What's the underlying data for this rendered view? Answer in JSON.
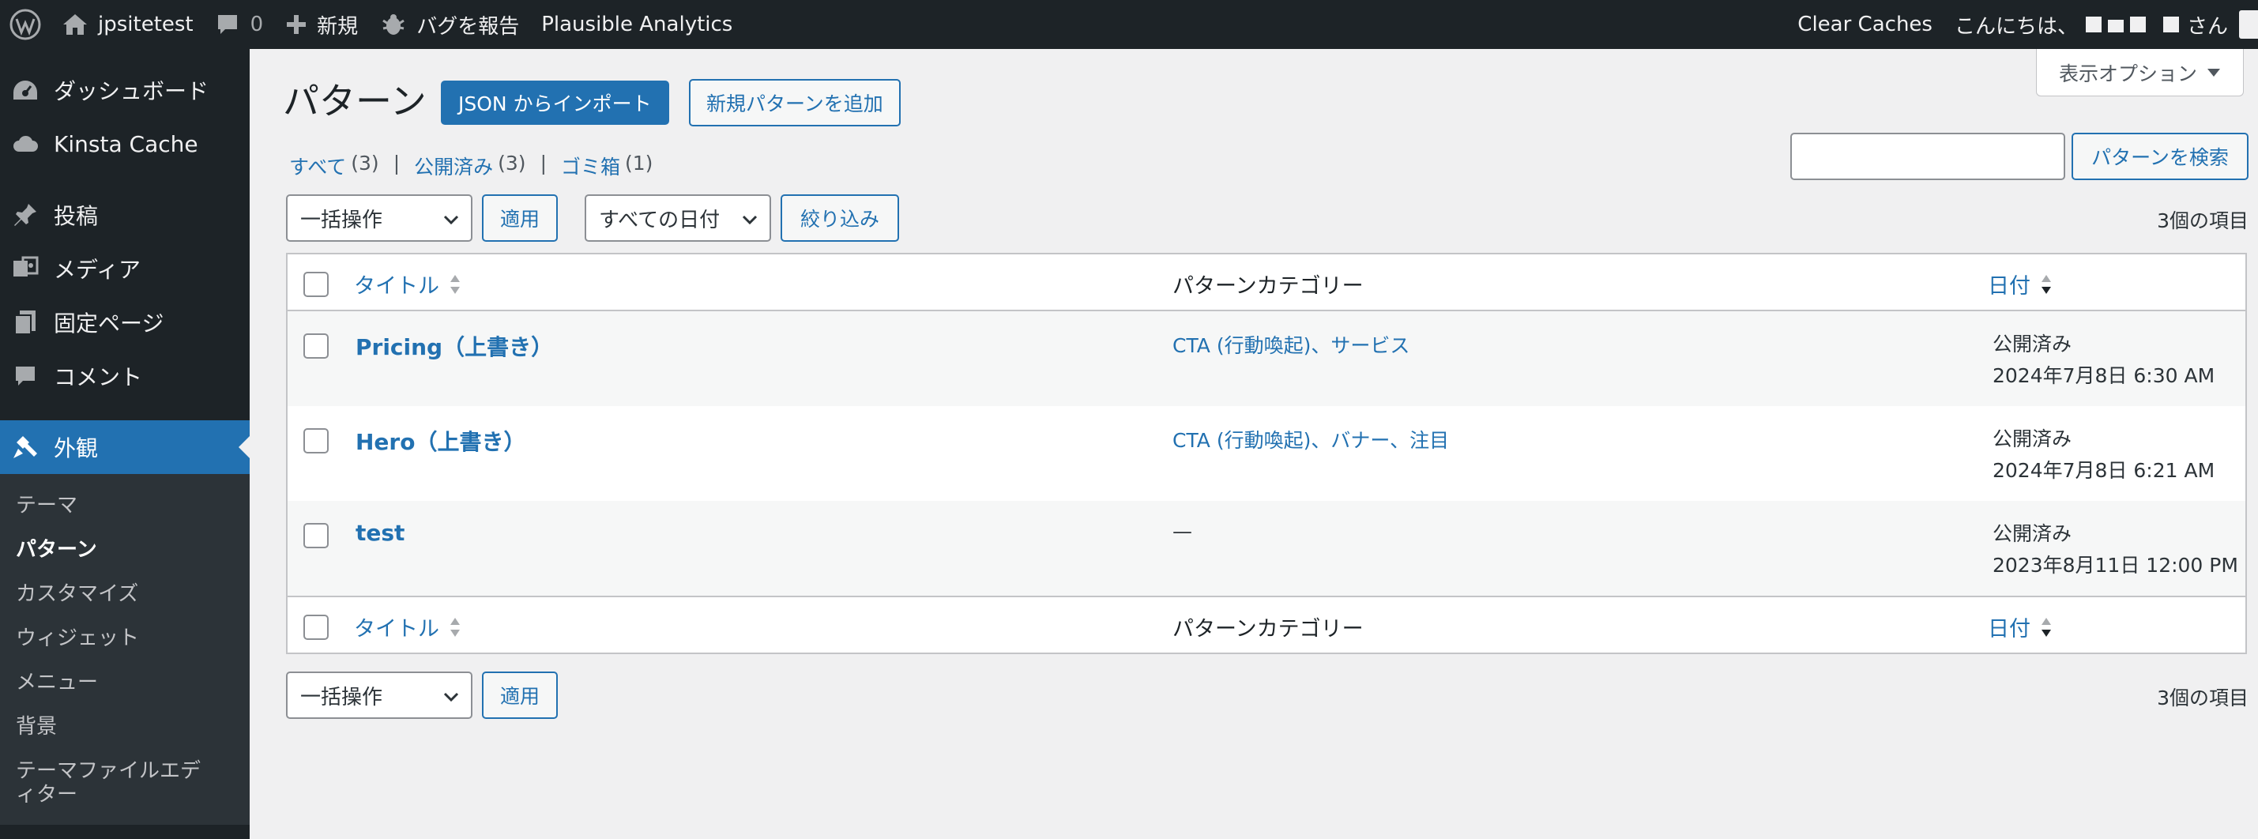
{
  "adminbar": {
    "site_name": "jpsitetest",
    "comments_count": "0",
    "new_label": "新規",
    "bug_report": "バグを報告",
    "analytics": "Plausible Analytics",
    "clear_caches": "Clear Caches",
    "greeting": "こんにちは、",
    "san": "さん"
  },
  "sidebar": {
    "items": [
      {
        "label": "ダッシュボード",
        "icon": "dashboard-icon"
      },
      {
        "label": "Kinsta Cache",
        "icon": "cloud-icon"
      },
      {
        "label": "投稿",
        "icon": "pin-icon"
      },
      {
        "label": "メディア",
        "icon": "media-icon"
      },
      {
        "label": "固定ページ",
        "icon": "pages-icon"
      },
      {
        "label": "コメント",
        "icon": "comment-icon"
      },
      {
        "label": "外観",
        "icon": "appearance-icon"
      }
    ],
    "submenu": [
      "テーマ",
      "パターン",
      "カスタマイズ",
      "ウィジェット",
      "メニュー",
      "背景",
      "テーマファイルエディター"
    ]
  },
  "main": {
    "screen_options": "表示オプション",
    "title": "パターン",
    "import_button": "JSON からインポート",
    "add_button": "新規パターンを追加",
    "views": {
      "all": "すべて",
      "all_count": "(3)",
      "published": "公開済み",
      "published_count": "(3)",
      "trash": "ゴミ箱",
      "trash_count": "(1)"
    },
    "search_button": "パターンを検索",
    "bulk_action": "一括操作",
    "apply": "適用",
    "all_dates": "すべての日付",
    "filter": "絞り込み",
    "items_count": "3個の項目",
    "columns": {
      "title": "タイトル",
      "category": "パターンカテゴリー",
      "date": "日付"
    },
    "rows": [
      {
        "title": "Pricing（上書き）",
        "categories": "CTA (行動喚起)、サービス",
        "status": "公開済み",
        "date": "2024年7月8日 6:30 AM"
      },
      {
        "title": "Hero（上書き）",
        "categories": "CTA (行動喚起)、バナー、注目",
        "status": "公開済み",
        "date": "2024年7月8日 6:21 AM"
      },
      {
        "title": "test",
        "categories": "—",
        "status": "公開済み",
        "date": "2023年8月11日 12:00 PM"
      }
    ]
  }
}
